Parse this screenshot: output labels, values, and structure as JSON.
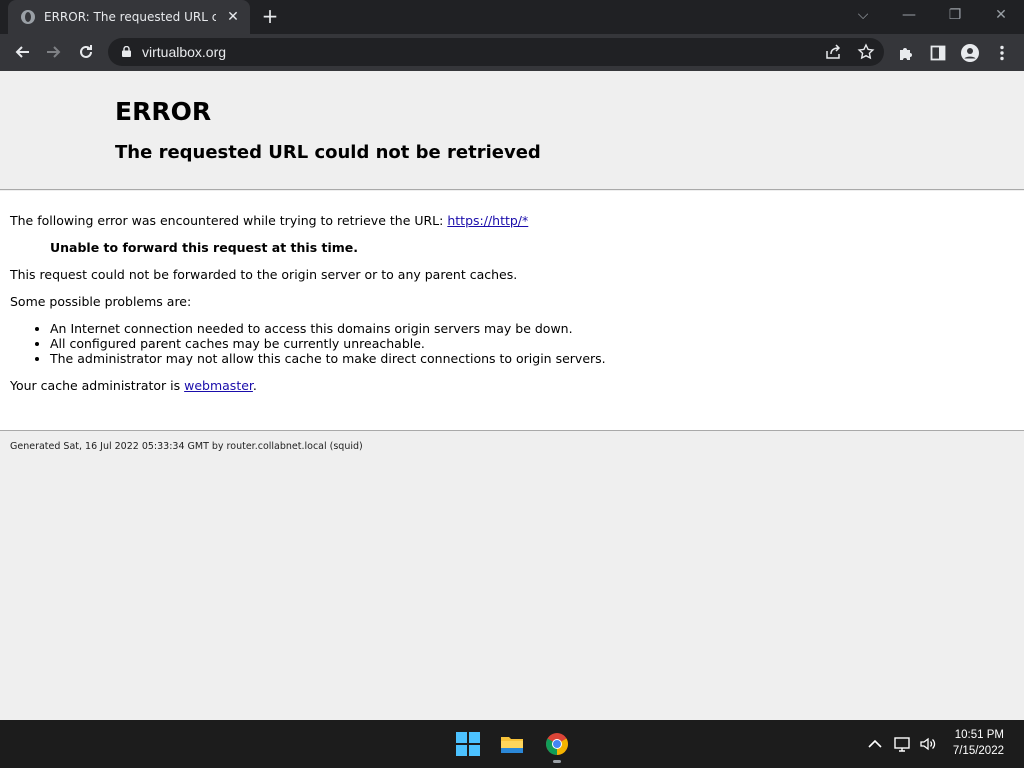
{
  "browser": {
    "tab_title": "ERROR: The requested URL could not be retrieved",
    "tab_close": "✕",
    "new_tab": "+",
    "window_controls": {
      "dropdown": "⌵",
      "minimize": "—",
      "restore": "❐",
      "close": "✕"
    },
    "url": "virtualbox.org"
  },
  "page": {
    "heading": "ERROR",
    "subheading": "The requested URL could not be retrieved",
    "intro_text": "The following error was encountered while trying to retrieve the URL: ",
    "intro_link": "https://http/*",
    "error_title": "Unable to forward this request at this time.",
    "forward_text": "This request could not be forwarded to the origin server or to any parent caches.",
    "problems_intro": "Some possible problems are:",
    "problems": [
      "An Internet connection needed to access this domains origin servers may be down.",
      "All configured parent caches may be currently unreachable.",
      "The administrator may not allow this cache to make direct connections to origin servers."
    ],
    "admin_prefix": "Your cache administrator is ",
    "admin_link": "webmaster",
    "admin_suffix": ".",
    "footer": "Generated Sat, 16 Jul 2022 05:33:34 GMT by router.collabnet.local (squid)"
  },
  "taskbar": {
    "time": "10:51 PM",
    "date": "7/15/2022"
  },
  "colors": {
    "chrome_dark": "#202124",
    "chrome_toolbar": "#35363a",
    "link": "#1a0dab",
    "taskbar": "#1c1c1c"
  }
}
